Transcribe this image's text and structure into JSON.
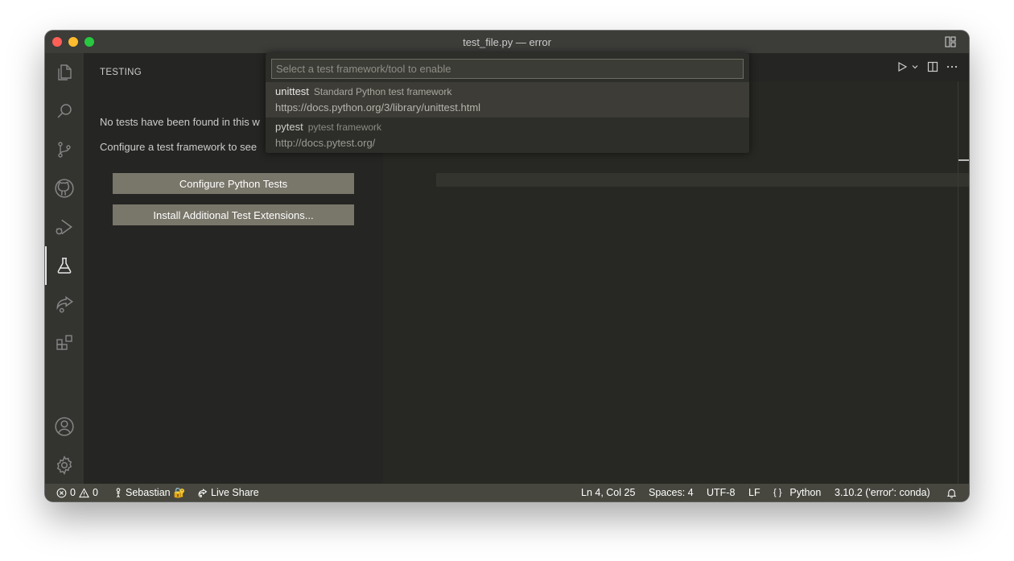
{
  "window": {
    "title": "test_file.py — error"
  },
  "sidebar": {
    "title": "TESTING",
    "no_tests_text": "No tests have been found in this w",
    "configure_text": "Configure a test framework to see",
    "configure_button": "Configure Python Tests",
    "install_button": "Install Additional Test Extensions..."
  },
  "quick_pick": {
    "placeholder": "Select a test framework/tool to enable",
    "items": [
      {
        "name": "unittest",
        "description": "Standard Python test framework",
        "detail": "https://docs.python.org/3/library/unittest.html"
      },
      {
        "name": "pytest",
        "description": "pytest framework",
        "detail": "http://docs.pytest.org/"
      }
    ]
  },
  "statusbar": {
    "errors": "0",
    "warnings": "0",
    "user": "Sebastian",
    "live_share": "Live Share",
    "cursor": "Ln 4, Col 25",
    "spaces": "Spaces: 4",
    "encoding": "UTF-8",
    "eol": "LF",
    "language": "Python",
    "interpreter": "3.10.2 ('error': conda)"
  },
  "icons": {
    "activity": [
      "files-icon",
      "search-icon",
      "source-control-icon",
      "github-icon",
      "run-debug-icon",
      "testing-icon",
      "live-share-icon",
      "extensions-icon",
      "account-icon",
      "settings-gear-icon"
    ]
  },
  "colors": {
    "accent_button": "#79766a",
    "statusbar": "#47473f",
    "titlebar": "#3c3c39"
  }
}
